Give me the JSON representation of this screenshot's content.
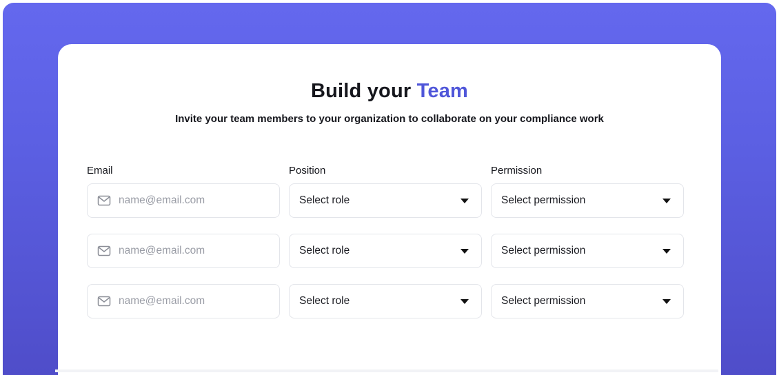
{
  "heading": {
    "title_main": "Build your",
    "title_accent": "Team",
    "subtitle": "Invite your team members to your organization to collaborate on your compliance work"
  },
  "columns": {
    "email_label": "Email",
    "position_label": "Position",
    "permission_label": "Permission"
  },
  "rows": [
    {
      "email_value": "",
      "email_placeholder": "name@email.com",
      "role": "Select role",
      "permission": "Select permission"
    },
    {
      "email_value": "",
      "email_placeholder": "name@email.com",
      "role": "Select role",
      "permission": "Select permission"
    },
    {
      "email_value": "",
      "email_placeholder": "name@email.com",
      "role": "Select role",
      "permission": "Select permission"
    }
  ],
  "icons": {
    "email_field_icon": "mail-icon",
    "dropdown_icon": "caret-down-icon"
  },
  "colors": {
    "background_gradient_top": "#6468ee",
    "background_gradient_bottom": "#4f4dc9",
    "accent": "#4f56d9",
    "text": "#15161c",
    "placeholder": "#9a9da6",
    "border": "#e3e5ea"
  }
}
